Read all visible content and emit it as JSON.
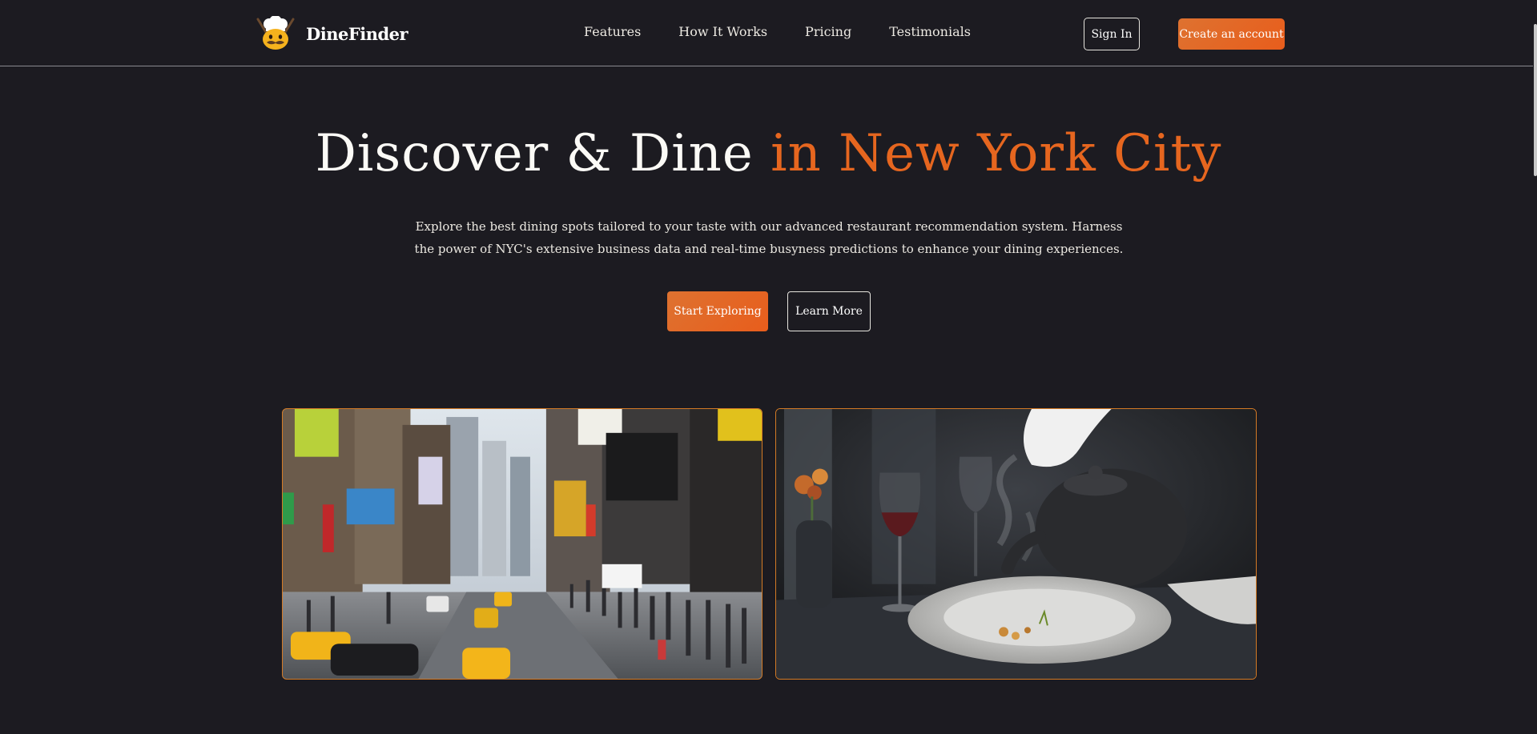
{
  "brand": {
    "name": "DineFinder",
    "logo_icon": "chef-mascot-icon"
  },
  "nav": {
    "links": [
      "Features",
      "How It Works",
      "Pricing",
      "Testimonials"
    ],
    "sign_in": "Sign In",
    "create_account": "Create an account"
  },
  "hero": {
    "title_main": "Discover & Dine",
    "title_accent": "in New York City",
    "description": "Explore the best dining spots tailored to your taste with our advanced restaurant recommendation system. Harness the power of NYC's extensive business data and real-time busyness predictions to enhance your dining experiences.",
    "primary_cta": "Start Exploring",
    "secondary_cta": "Learn More"
  },
  "images": {
    "left_subject": "nyc-times-square-street-photo",
    "right_subject": "fine-dining-tea-pour-photo"
  },
  "colors": {
    "background": "#1c1b21",
    "accent": "#e6661f",
    "button_gradient_start": "#de7230",
    "button_gradient_end": "#e85d1c",
    "image_border": "#d47a25"
  }
}
